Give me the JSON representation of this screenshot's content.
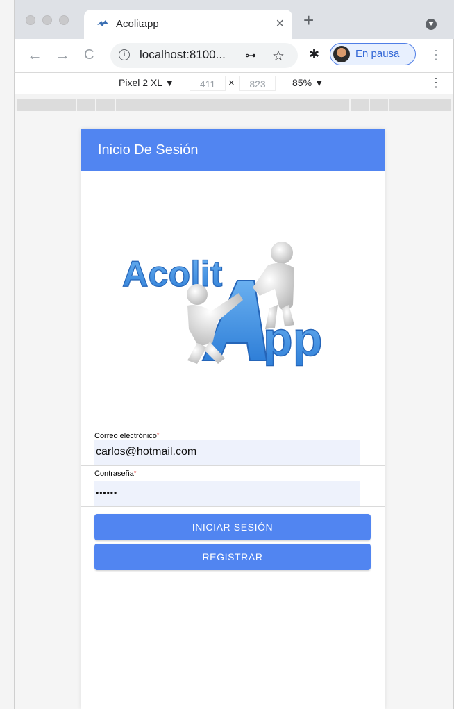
{
  "browser": {
    "tab_title": "Acolitapp",
    "tab_close": "×",
    "new_tab": "+",
    "url": "localhost:8100...",
    "profile_status": "En pausa"
  },
  "devtools": {
    "device": "Pixel 2 XL ▼",
    "width": "411",
    "times": "×",
    "height": "823",
    "zoom": "85% ▼"
  },
  "app": {
    "header_title": "Inicio De Sesión",
    "logo_text": "AcolitApp",
    "email_label": "Correo electrónico",
    "email_value": "carlos@hotmail.com",
    "password_label": "Contraseña",
    "password_value": "••••••",
    "required_mark": "*",
    "login_button": "INICIAR SESIÓN",
    "register_button": "REGISTRAR",
    "accent_color": "#5185f1"
  },
  "icons": {
    "back": "←",
    "forward": "→",
    "reload": "C",
    "key": "⊶",
    "star": "☆",
    "extension": "✱",
    "menu": "⋮",
    "favicon": "𝍶"
  }
}
